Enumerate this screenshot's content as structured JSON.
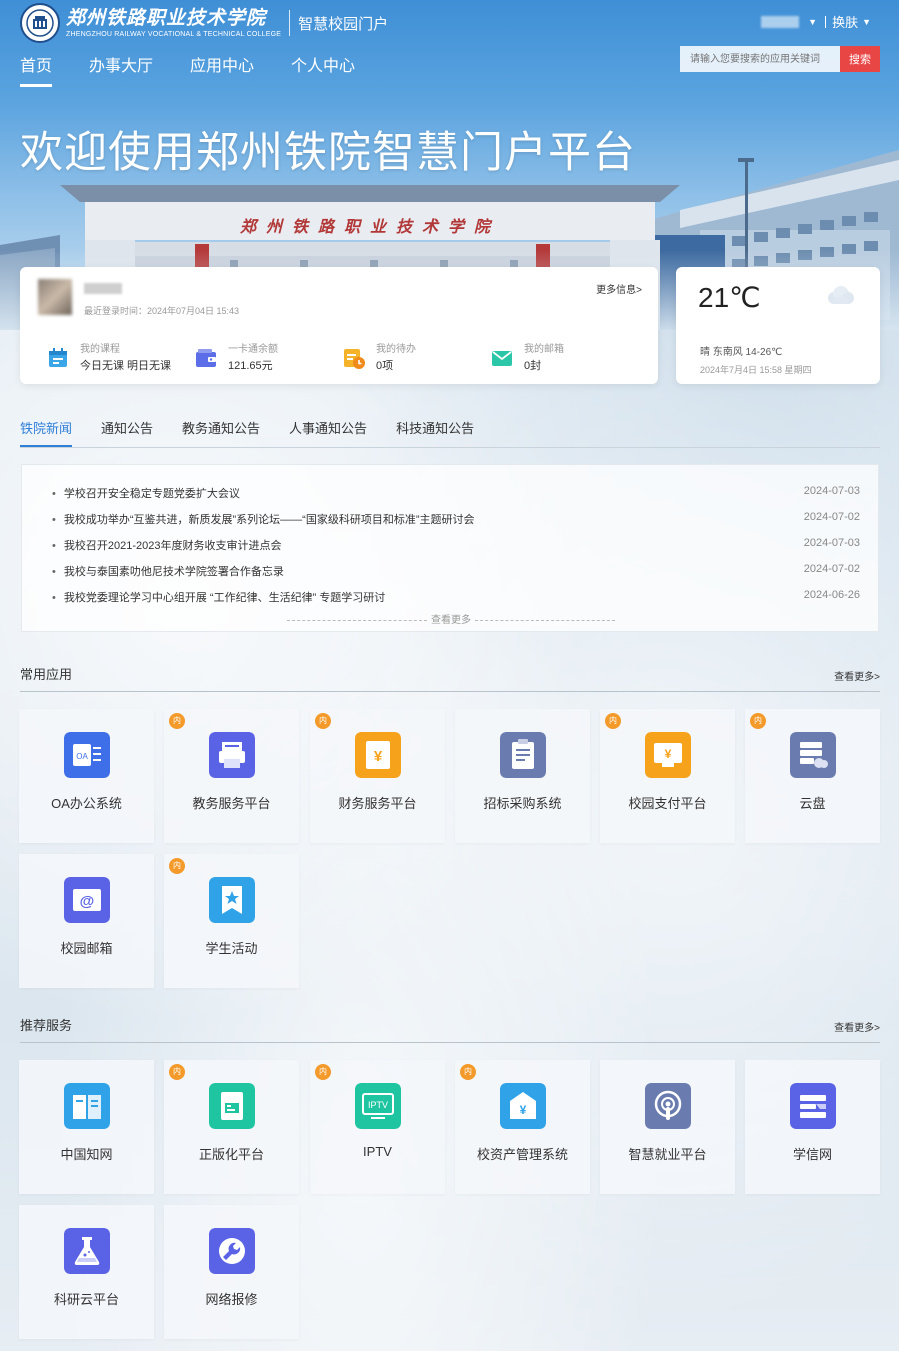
{
  "header": {
    "logo_cn": "郑州铁路职业技术学院",
    "logo_en": "ZHENGZHOU RAILWAY VOCATIONAL & TECHNICAL COLLEGE",
    "portal_name": "智慧校园门户",
    "skin_label": "换肤",
    "nav": [
      {
        "label": "首页",
        "active": true
      },
      {
        "label": "办事大厅"
      },
      {
        "label": "应用中心"
      },
      {
        "label": "个人中心"
      }
    ],
    "search_placeholder": "请输入您要搜索的应用关键词",
    "search_button": "搜索"
  },
  "hero": {
    "title": "欢迎使用郑州铁院智慧门户平台",
    "gate_sign": "郑州铁路职业技术学院"
  },
  "profile": {
    "last_login": "最近登录时间：2024年07月04日 15:43",
    "more_info": "更多信息>",
    "stats": [
      {
        "label": "我的课程",
        "value": "今日无课  明日无课",
        "icon": "calendar-icon",
        "color": "#3aa6e8"
      },
      {
        "label": "一卡通余额",
        "value": "121.65元",
        "icon": "wallet-icon",
        "color": "#5b6ee8"
      },
      {
        "label": "我的待办",
        "value": "0项",
        "icon": "todo-clock-icon",
        "color": "#f5b32a"
      },
      {
        "label": "我的邮箱",
        "value": "0封",
        "icon": "mail-icon",
        "color": "#2cc7a8"
      }
    ]
  },
  "weather": {
    "temp": "21℃",
    "desc": "晴  东南风  14-26℃",
    "date": "2024年7月4日 15:58 星期四"
  },
  "tabs": [
    {
      "label": "铁院新闻",
      "active": true
    },
    {
      "label": "通知公告"
    },
    {
      "label": "教务通知公告"
    },
    {
      "label": "人事通知公告"
    },
    {
      "label": "科技通知公告"
    }
  ],
  "news": {
    "items": [
      {
        "title": "学校召开安全稳定专题党委扩大会议",
        "date": "2024-07-03"
      },
      {
        "title": "我校成功举办“互鉴共进，新质发展”系列论坛——“国家级科研项目和标准”主题研讨会",
        "date": "2024-07-02"
      },
      {
        "title": "我校召开2021-2023年度财务收支审计进点会",
        "date": "2024-07-03"
      },
      {
        "title": "我校与泰国素叻他尼技术学院签署合作备忘录",
        "date": "2024-07-02"
      },
      {
        "title": "我校党委理论学习中心组开展 “工作纪律、生活纪律” 专题学习研讨",
        "date": "2024-06-26"
      }
    ],
    "view_more": "查看更多"
  },
  "common_apps": {
    "title": "常用应用",
    "more": "查看更多>",
    "badge": "内",
    "items": [
      {
        "label": "OA办公系统",
        "icon": "oa-icon",
        "color": "#3f6fe8",
        "badge": false
      },
      {
        "label": "教务服务平台",
        "icon": "printer-icon",
        "color": "#5a62e6",
        "badge": true
      },
      {
        "label": "财务服务平台",
        "icon": "finance-icon",
        "color": "#f7a21b",
        "badge": true
      },
      {
        "label": "招标采购系统",
        "icon": "clipboard-icon",
        "color": "#6a7bb0",
        "badge": false
      },
      {
        "label": "校园支付平台",
        "icon": "payment-icon",
        "color": "#f7a21b",
        "badge": true
      },
      {
        "label": "云盘",
        "icon": "cloud-drive-icon",
        "color": "#6a7bb0",
        "badge": true
      },
      {
        "label": "校园邮箱",
        "icon": "email-icon",
        "color": "#5a62e6",
        "badge": false
      },
      {
        "label": "学生活动",
        "icon": "star-bookmark-icon",
        "color": "#2fa2e8",
        "badge": true
      }
    ]
  },
  "recommended": {
    "title": "推荐服务",
    "more": "查看更多>",
    "badge": "内",
    "items": [
      {
        "label": "中国知网",
        "icon": "book-icon",
        "color": "#2fa2e8",
        "badge": false
      },
      {
        "label": "正版化平台",
        "icon": "document-icon",
        "color": "#1fc5a0",
        "badge": true
      },
      {
        "label": "IPTV",
        "icon": "tv-icon",
        "color": "#1fc5a0",
        "badge": true,
        "icon_text": "IPTV"
      },
      {
        "label": "校资产管理系统",
        "icon": "asset-icon",
        "color": "#2fa2e8",
        "badge": true,
        "icon_text": "¥"
      },
      {
        "label": "智慧就业平台",
        "icon": "podcast-icon",
        "color": "#6a7bb0",
        "badge": false
      },
      {
        "label": "学信网",
        "icon": "graduation-icon",
        "color": "#5a62e6",
        "badge": false
      },
      {
        "label": "科研云平台",
        "icon": "flask-icon",
        "color": "#5a62e6",
        "badge": false
      },
      {
        "label": "网络报修",
        "icon": "wrench-icon",
        "color": "#5a62e6",
        "badge": false
      }
    ]
  }
}
